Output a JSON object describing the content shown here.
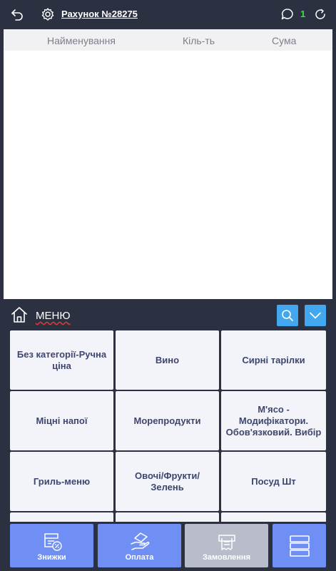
{
  "header": {
    "title": "Рахунок №28275",
    "notifications_count": "1"
  },
  "order": {
    "columns": [
      "Найменування",
      "Кіль-ть",
      "Сума"
    ]
  },
  "menu": {
    "label": "МЕНЮ",
    "categories": [
      "Без категорії-Ручна ціна",
      "Вино",
      "Сирні тарілки",
      "Міцні напої",
      "Морепродукти",
      "М'ясо - Модифікатори. Обов'язковий. Вибір",
      "Гриль-меню",
      "Овочі/Фрукти/Зелень",
      "Посуд Шт",
      "",
      "",
      ""
    ]
  },
  "actions": {
    "discounts": "Знижки",
    "payment": "Оплата",
    "order": "Замовлення"
  },
  "colors": {
    "background": "#2b3140",
    "accent": "#42a7ee",
    "action": "#6f8ff5",
    "action_disabled": "#b8bccb",
    "count_green": "#3fd94f"
  }
}
